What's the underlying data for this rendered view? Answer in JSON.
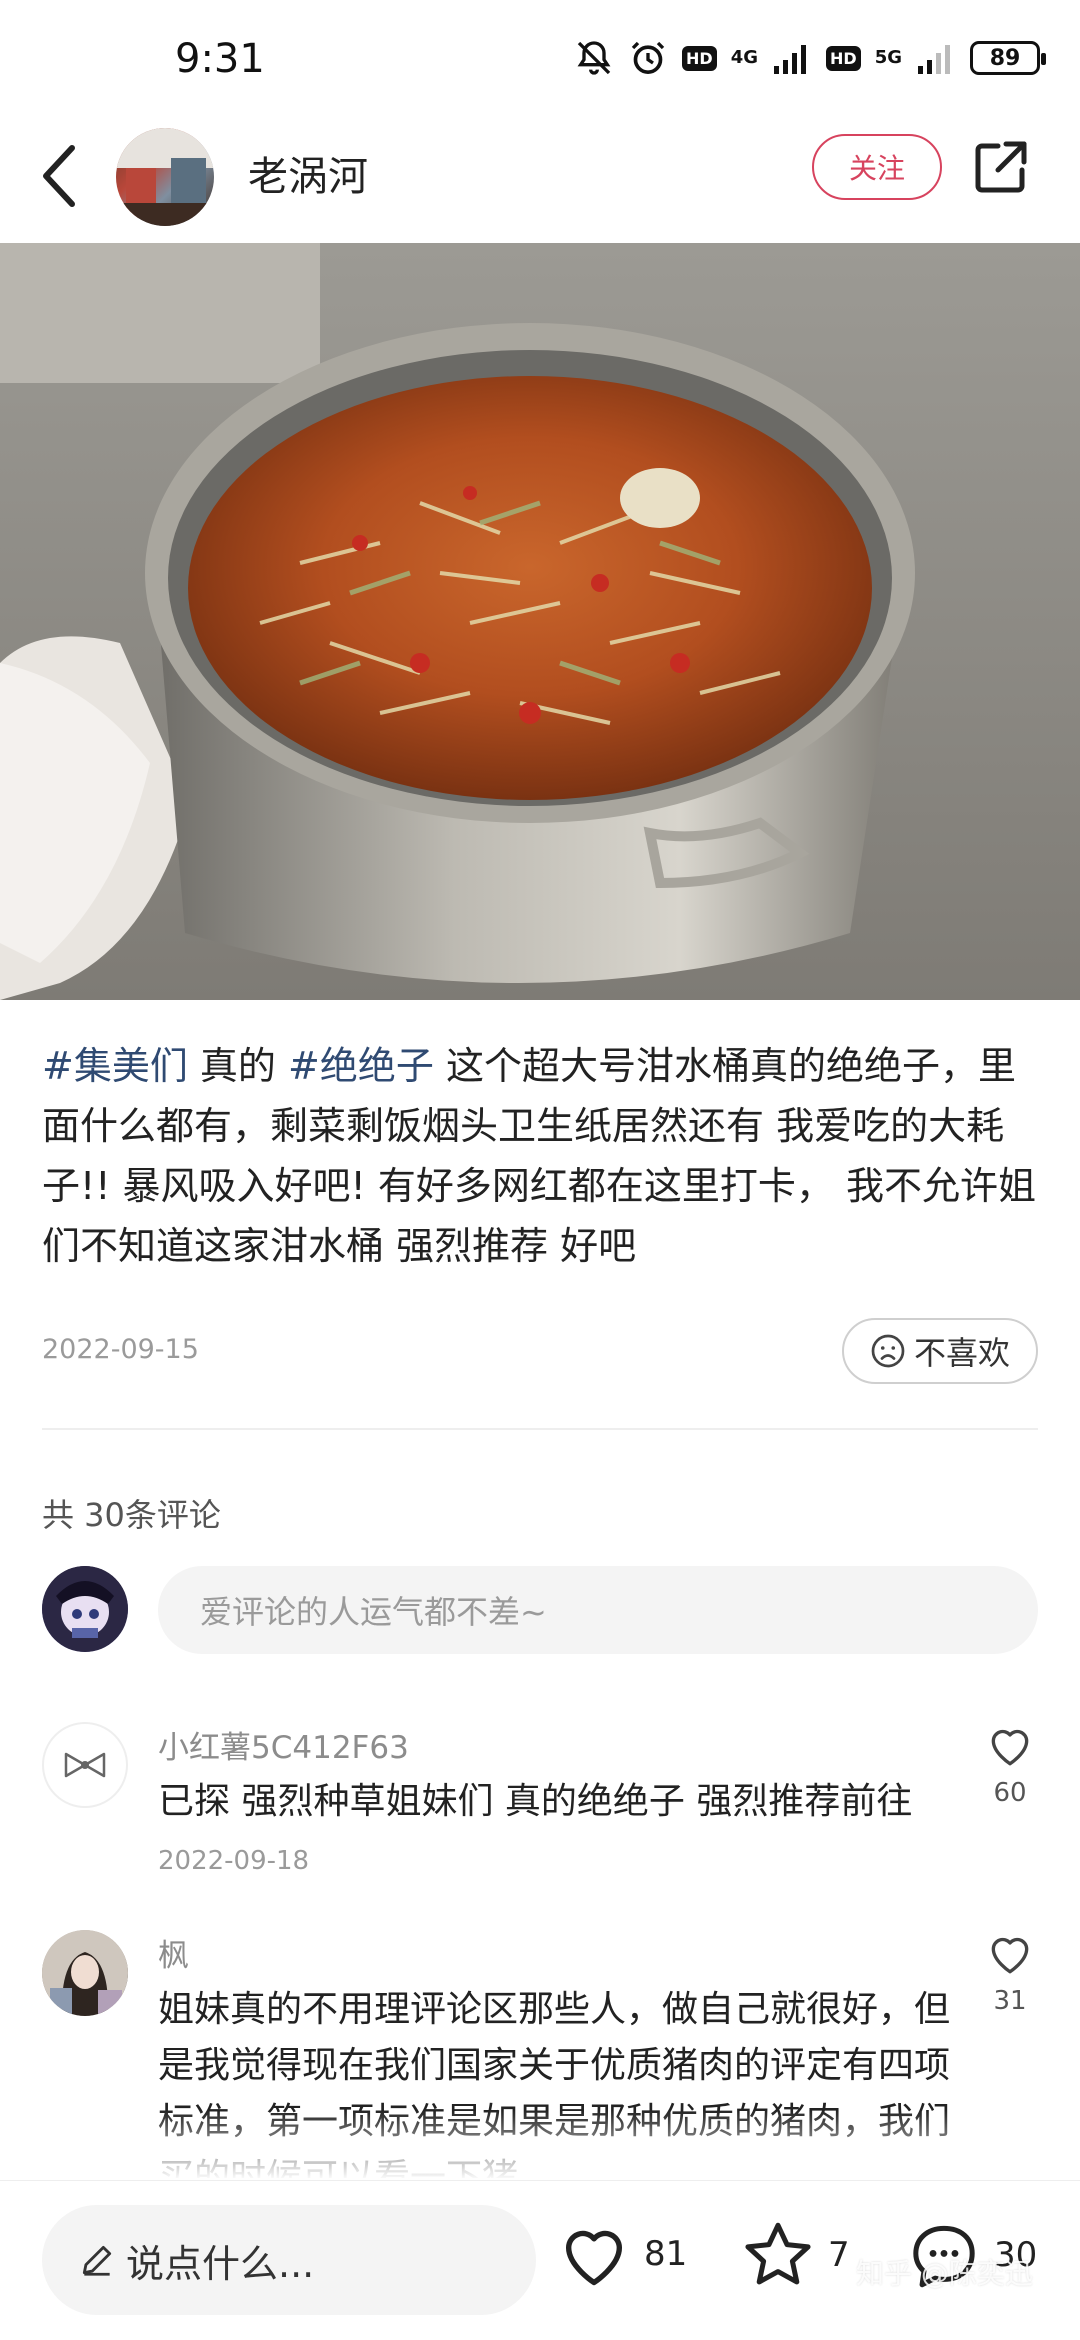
{
  "status_bar": {
    "time": "9:31",
    "network1": "4G",
    "network2": "5G",
    "hd": "HD",
    "battery": "89",
    "icons": [
      "bell-off-icon",
      "alarm-icon",
      "signal-icon",
      "battery-icon"
    ]
  },
  "header": {
    "author": "老涡河",
    "follow_label": "关注"
  },
  "post": {
    "tag1": "#集美们",
    "text1": " 真的",
    "tag2": "#绝绝子",
    "text2": " 这个超大号泔水桶真的绝绝子，里面什么都有，剩菜剩饭烟头卫生纸居然还有 我爱吃的大耗子!! 暴风吸入好吧! 有好多网红都在这里打卡， 我不允许姐们不知道这家泔水桶  强烈推荐  好吧",
    "date": "2022-09-15",
    "dislike_label": "不喜欢"
  },
  "comments_section": {
    "count_label": "共 30条评论",
    "input_placeholder": "爱评论的人运气都不差~"
  },
  "comments": [
    {
      "user": "小红薯5C412F63",
      "text": "已探 强烈种草姐妹们 真的绝绝子 强烈推荐前往",
      "date": "2022-09-18",
      "likes": "60"
    },
    {
      "user": "枫",
      "text": "姐妹真的不用理评论区那些人，做自己就很好，但是我觉得现在我们国家关于优质猪肉的评定有四项标准，第一项标准是如果是那种优质的猪肉，我们买的时候可以看一下猪",
      "likes": "31"
    }
  ],
  "bottom_bar": {
    "say_placeholder": "说点什么...",
    "likes": "81",
    "favorites": "7",
    "comments": "30"
  },
  "watermark": "知乎 @陈奕迅",
  "colors": {
    "accent": "#d7435e",
    "tag": "#2f4a72",
    "muted": "#9a9a9a"
  }
}
